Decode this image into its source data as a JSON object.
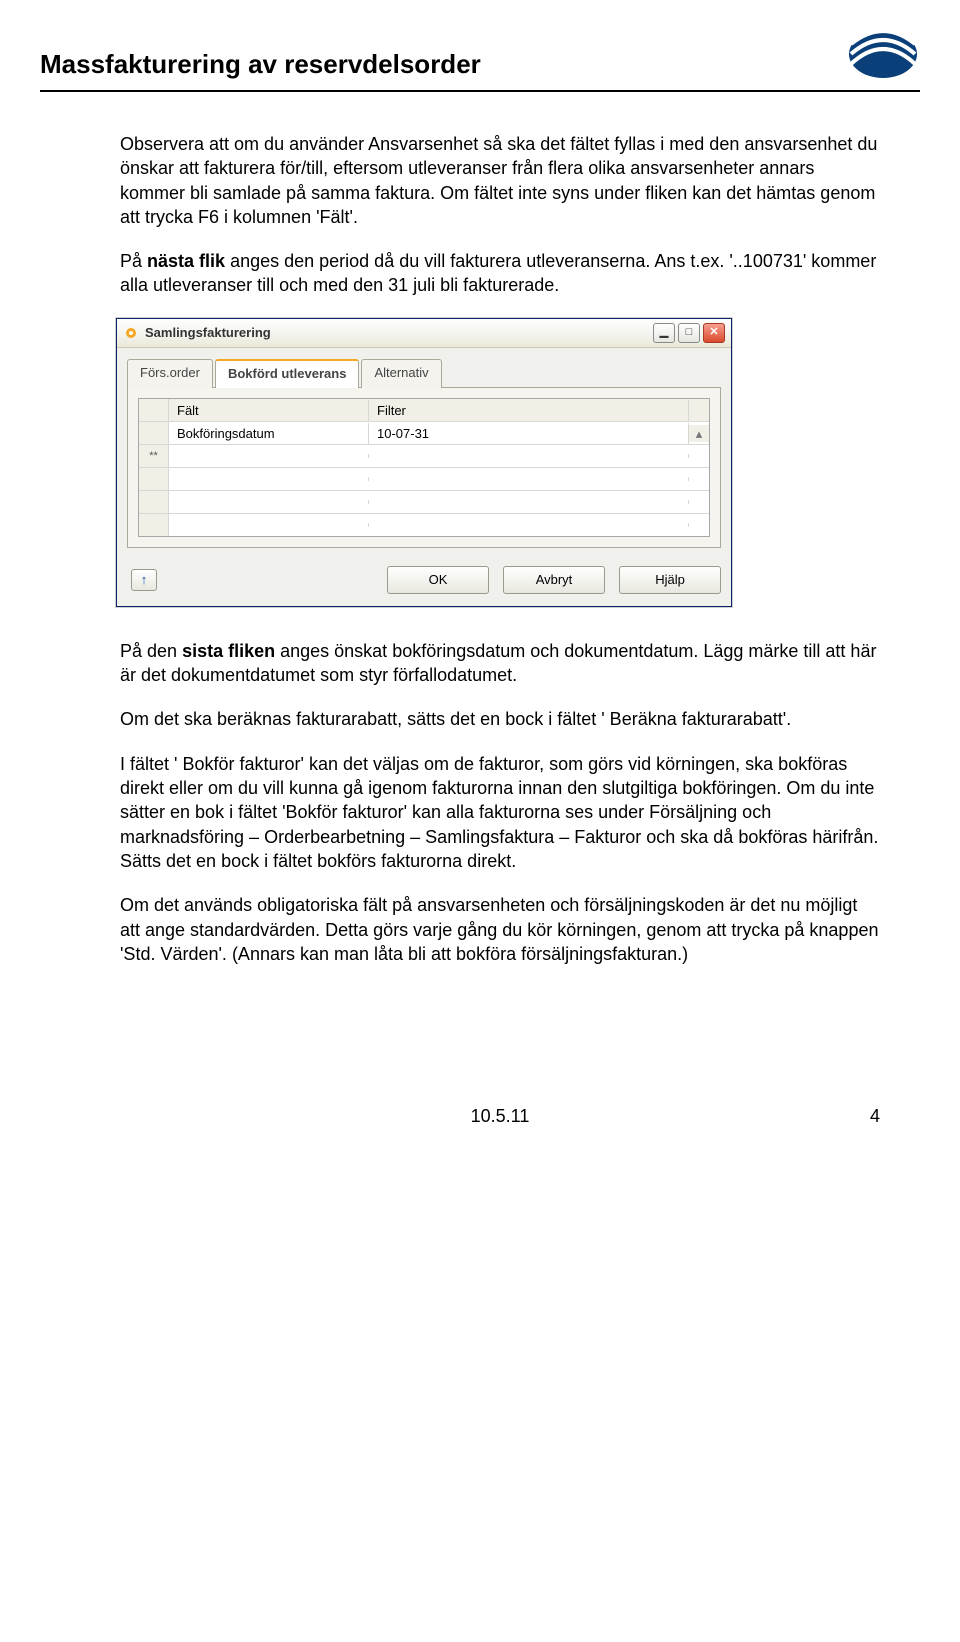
{
  "header": {
    "title": "Massfakturering av reservdelsorder"
  },
  "paragraphs": {
    "p1": "Observera att om du använder Ansvarsenhet så ska det fältet fyllas i med den ansvarsenhet du önskar att fakturera för/till, eftersom utleveranser från flera olika ansvarsenheter annars kommer bli samlade på samma faktura. Om fältet inte syns under fliken kan det hämtas genom att trycka F6 i kolumnen 'Fält'.",
    "p2_a": "På ",
    "p2_b": "nästa flik",
    "p2_c": " anges den period då du vill fakturera utleveranserna. Ans t.ex. '..100731' kommer alla utleveranser till och med den 31 juli bli fakturerade.",
    "p3_a": "På den ",
    "p3_b": "sista fliken",
    "p3_c": " anges önskat bokföringsdatum och dokumentdatum. Lägg märke till att här är det dokumentdatumet som styr förfallodatumet.",
    "p4": "Om det ska beräknas fakturarabatt, sätts det en bock i fältet ' Beräkna fakturarabatt'.",
    "p5": "I fältet ' Bokför fakturor' kan det väljas om de fakturor, som görs vid körningen, ska bokföras direkt eller om du vill kunna gå igenom fakturorna innan den slutgiltiga bokföringen. Om du inte sätter en bok i fältet 'Bokför fakturor' kan alla fakturorna ses under Försäljning och marknadsföring – Orderbearbetning – Samlingsfaktura – Fakturor och ska då bokföras härifrån. Sätts det en bock i fältet bokförs fakturorna direkt.",
    "p6": "Om det används obligatoriska fält på ansvarsenheten och försäljningskoden är det nu möjligt att ange standardvärden. Detta görs varje gång du kör körningen, genom att trycka på knappen 'Std. Värden'. (Annars kan man låta bli att bokföra försäljningsfakturan.)"
  },
  "dialog": {
    "title": "Samlingsfakturering",
    "tabs": {
      "t0": "Förs.order",
      "t1": "Bokförd utleverans",
      "t2": "Alternativ"
    },
    "grid": {
      "head_field": "Fält",
      "head_filter": "Filter",
      "r0_field": "Bokföringsdatum",
      "r0_filter": "10-07-31",
      "new_marker": "**"
    },
    "up_arrow": "↑",
    "scroll_up": "▴",
    "buttons": {
      "ok": "OK",
      "cancel": "Avbryt",
      "help": "Hjälp"
    },
    "win": {
      "min": "▁",
      "max": "□",
      "close": "✕"
    }
  },
  "footer": {
    "date": "10.5.11",
    "page": "4"
  }
}
